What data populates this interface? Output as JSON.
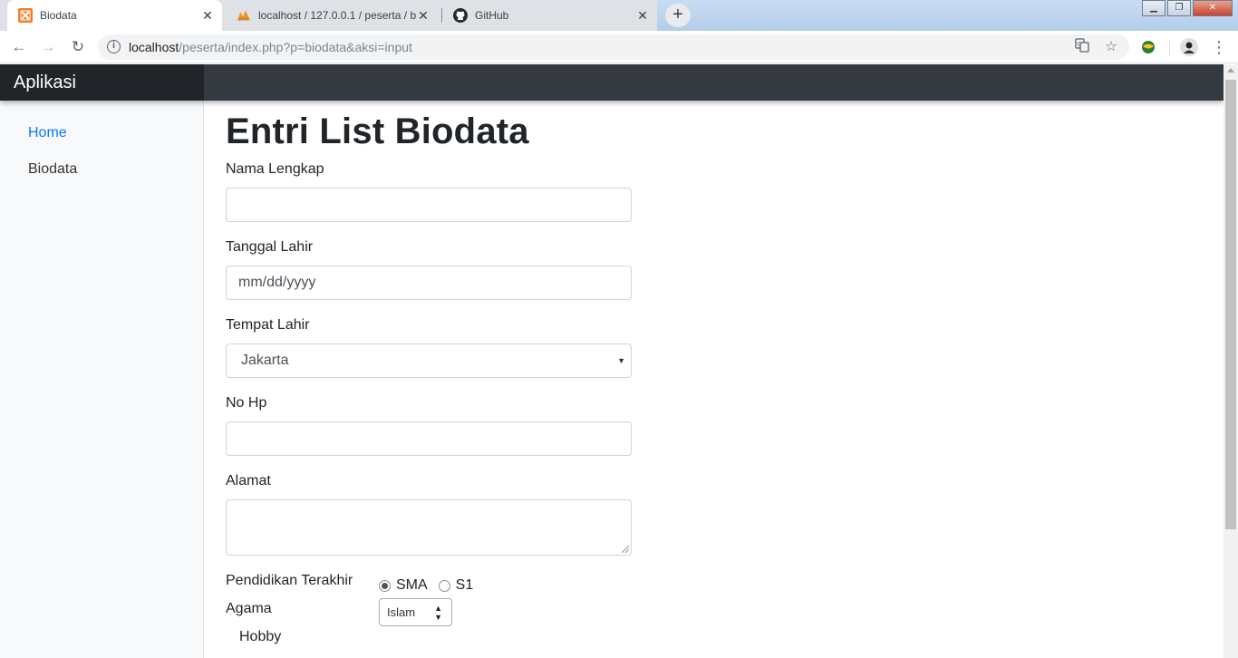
{
  "browser": {
    "tabs": [
      {
        "title": "Biodata",
        "favicon": "xampp-icon",
        "active": true
      },
      {
        "title": "localhost / 127.0.0.1 / peserta / b",
        "favicon": "phpmyadmin-icon",
        "active": false
      },
      {
        "title": "GitHub",
        "favicon": "github-icon",
        "active": false
      }
    ],
    "url_host": "localhost",
    "url_path": "/peserta/index.php?p=biodata&aksi=input"
  },
  "app": {
    "brand": "Aplikasi",
    "sidebar": [
      {
        "label": "Home",
        "active": true
      },
      {
        "label": "Biodata",
        "active": false
      }
    ]
  },
  "form": {
    "title": "Entri List Biodata",
    "nama_label": "Nama Lengkap",
    "nama_value": "",
    "tanggal_label": "Tanggal Lahir",
    "tanggal_placeholder": "mm/dd/yyyy",
    "tempat_label": "Tempat Lahir",
    "tempat_value": "Jakarta",
    "hp_label": "No Hp",
    "hp_value": "",
    "alamat_label": "Alamat",
    "alamat_value": "",
    "pendidikan_label": "Pendidikan Terakhir",
    "pendidikan_options": [
      "SMA",
      "S1"
    ],
    "pendidikan_selected": "SMA",
    "agama_label": "Agama",
    "agama_value": "Islam",
    "hobby_label": "Hobby"
  },
  "colors": {
    "navbar": "#343a40",
    "brand_bg": "#212529",
    "link_active": "#007bff",
    "sidebar_bg": "#f8f9fa"
  }
}
